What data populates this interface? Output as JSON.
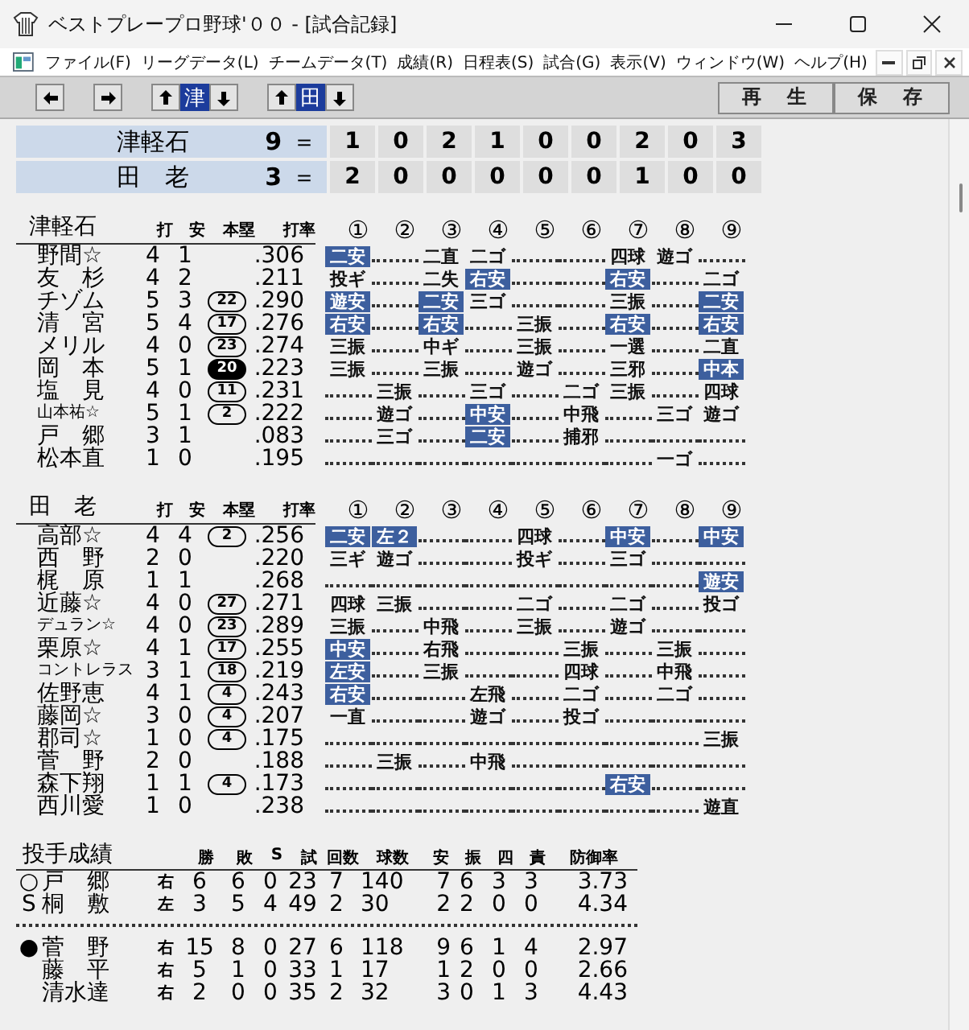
{
  "window": {
    "title": "ベストプレープロ野球'００ - [試合記録]"
  },
  "menu": [
    "ファイル(F)",
    "リーグデータ(L)",
    "チームデータ(T)",
    "成績(R)",
    "日程表(S)",
    "試合(G)",
    "表示(V)",
    "ウィンドウ(W)",
    "ヘルプ(H)"
  ],
  "toolbar": {
    "teams": [
      {
        "label": "津",
        "selected": true
      },
      {
        "label": "田",
        "selected": true
      }
    ],
    "buttons": [
      "再　生",
      "保　存"
    ]
  },
  "scoreboard": [
    {
      "team": "津軽石",
      "runs": "9",
      "separator": "＝",
      "innings": [
        "1",
        "0",
        "2",
        "1",
        "0",
        "0",
        "2",
        "0",
        "3"
      ]
    },
    {
      "team": "田　老",
      "runs": "3",
      "separator": "＝",
      "innings": [
        "2",
        "0",
        "0",
        "0",
        "0",
        "0",
        "1",
        "0",
        "0"
      ]
    }
  ],
  "batting": [
    {
      "team": "津軽石",
      "columns": [
        "打",
        "安",
        "本塁",
        "打率"
      ],
      "innings": [
        "①",
        "②",
        "③",
        "④",
        "⑤",
        "⑥",
        "⑦",
        "⑧",
        "⑨"
      ],
      "batters": [
        {
          "name": "野間☆",
          "compact": false,
          "ab": "4",
          "h": "1",
          "avg": ".306",
          "results": [
            {
              "kind": "hit",
              "text": "二安"
            },
            {
              "kind": "dots"
            },
            {
              "kind": "out",
              "text": "二直"
            },
            {
              "kind": "out",
              "text": "二ゴ"
            },
            {
              "kind": "dots"
            },
            {
              "kind": "dots"
            },
            {
              "kind": "out",
              "text": "四球"
            },
            {
              "kind": "out",
              "text": "遊ゴ"
            },
            {
              "kind": "dots"
            }
          ]
        },
        {
          "name": "友　杉",
          "compact": false,
          "ab": "4",
          "h": "2",
          "avg": ".211",
          "results": [
            {
              "kind": "out",
              "text": "投ギ"
            },
            {
              "kind": "dots"
            },
            {
              "kind": "out",
              "text": "二失"
            },
            {
              "kind": "hit",
              "text": "右安"
            },
            {
              "kind": "dots"
            },
            {
              "kind": "dots"
            },
            {
              "kind": "hit",
              "text": "右安"
            },
            {
              "kind": "dots"
            },
            {
              "kind": "out",
              "text": "二ゴ"
            }
          ]
        },
        {
          "name": "チゾム",
          "compact": false,
          "ab": "5",
          "h": "3",
          "hr": "22",
          "hr_filled": false,
          "avg": ".290",
          "results": [
            {
              "kind": "hit",
              "text": "遊安"
            },
            {
              "kind": "dots"
            },
            {
              "kind": "hit",
              "text": "二安"
            },
            {
              "kind": "out",
              "text": "三ゴ"
            },
            {
              "kind": "dots"
            },
            {
              "kind": "dots"
            },
            {
              "kind": "out",
              "text": "三振"
            },
            {
              "kind": "dots"
            },
            {
              "kind": "hit",
              "text": "二安"
            }
          ]
        },
        {
          "name": "清　宮",
          "compact": false,
          "ab": "5",
          "h": "4",
          "hr": "17",
          "hr_filled": false,
          "avg": ".276",
          "results": [
            {
              "kind": "hit",
              "text": "右安"
            },
            {
              "kind": "dots"
            },
            {
              "kind": "hit",
              "text": "右安"
            },
            {
              "kind": "dots"
            },
            {
              "kind": "out",
              "text": "三振"
            },
            {
              "kind": "dots"
            },
            {
              "kind": "hit",
              "text": "右安"
            },
            {
              "kind": "dots"
            },
            {
              "kind": "hit",
              "text": "右安"
            }
          ]
        },
        {
          "name": "メリル",
          "compact": false,
          "ab": "4",
          "h": "0",
          "hr": "23",
          "hr_filled": false,
          "avg": ".274",
          "results": [
            {
              "kind": "out",
              "text": "三振"
            },
            {
              "kind": "dots"
            },
            {
              "kind": "out",
              "text": "中ギ"
            },
            {
              "kind": "dots"
            },
            {
              "kind": "out",
              "text": "三振"
            },
            {
              "kind": "dots"
            },
            {
              "kind": "out",
              "text": "一選"
            },
            {
              "kind": "dots"
            },
            {
              "kind": "out",
              "text": "二直"
            }
          ]
        },
        {
          "name": "岡　本",
          "compact": false,
          "ab": "5",
          "h": "1",
          "hr": "20",
          "hr_filled": true,
          "avg": ".223",
          "results": [
            {
              "kind": "out",
              "text": "三振"
            },
            {
              "kind": "dots"
            },
            {
              "kind": "out",
              "text": "三振"
            },
            {
              "kind": "dots"
            },
            {
              "kind": "out",
              "text": "遊ゴ"
            },
            {
              "kind": "dots"
            },
            {
              "kind": "out",
              "text": "三邪"
            },
            {
              "kind": "dots"
            },
            {
              "kind": "hit",
              "text": "中本"
            }
          ]
        },
        {
          "name": "塩　見",
          "compact": false,
          "ab": "4",
          "h": "0",
          "hr": "11",
          "hr_filled": false,
          "avg": ".231",
          "results": [
            {
              "kind": "dots"
            },
            {
              "kind": "out",
              "text": "三振"
            },
            {
              "kind": "dots"
            },
            {
              "kind": "out",
              "text": "三ゴ"
            },
            {
              "kind": "dots"
            },
            {
              "kind": "out",
              "text": "二ゴ"
            },
            {
              "kind": "out",
              "text": "三振"
            },
            {
              "kind": "dots"
            },
            {
              "kind": "out",
              "text": "四球"
            }
          ]
        },
        {
          "name": "山本祐☆",
          "compact": true,
          "ab": "5",
          "h": "1",
          "hr": "2",
          "hr_filled": false,
          "avg": ".222",
          "results": [
            {
              "kind": "dots"
            },
            {
              "kind": "out",
              "text": "遊ゴ"
            },
            {
              "kind": "dots"
            },
            {
              "kind": "hit",
              "text": "中安"
            },
            {
              "kind": "dots"
            },
            {
              "kind": "out",
              "text": "中飛"
            },
            {
              "kind": "dots"
            },
            {
              "kind": "out",
              "text": "三ゴ"
            },
            {
              "kind": "out",
              "text": "遊ゴ"
            }
          ]
        },
        {
          "name": "戸　郷",
          "compact": false,
          "ab": "3",
          "h": "1",
          "avg": ".083",
          "results": [
            {
              "kind": "dots"
            },
            {
              "kind": "out",
              "text": "三ゴ"
            },
            {
              "kind": "dots"
            },
            {
              "kind": "hit",
              "text": "二安"
            },
            {
              "kind": "dots"
            },
            {
              "kind": "out",
              "text": "捕邪"
            },
            {
              "kind": "dots"
            },
            {
              "kind": "dots"
            },
            {
              "kind": "dots"
            }
          ]
        },
        {
          "name": "松本直",
          "compact": false,
          "ab": "1",
          "h": "0",
          "avg": ".195",
          "results": [
            {
              "kind": "dots"
            },
            {
              "kind": "dots"
            },
            {
              "kind": "dots"
            },
            {
              "kind": "dots"
            },
            {
              "kind": "dots"
            },
            {
              "kind": "dots"
            },
            {
              "kind": "dots"
            },
            {
              "kind": "out",
              "text": "一ゴ"
            },
            {
              "kind": "dots"
            }
          ]
        }
      ]
    },
    {
      "team": "田　老",
      "columns": [
        "打",
        "安",
        "本塁",
        "打率"
      ],
      "innings": [
        "①",
        "②",
        "③",
        "④",
        "⑤",
        "⑥",
        "⑦",
        "⑧",
        "⑨"
      ],
      "batters": [
        {
          "name": "高部☆",
          "compact": false,
          "ab": "4",
          "h": "4",
          "hr": "2",
          "hr_filled": false,
          "avg": ".256",
          "results": [
            {
              "kind": "hit",
              "text": "二安"
            },
            {
              "kind": "hit",
              "text": "左２"
            },
            {
              "kind": "dots"
            },
            {
              "kind": "dots"
            },
            {
              "kind": "out",
              "text": "四球"
            },
            {
              "kind": "dots"
            },
            {
              "kind": "hit",
              "text": "中安"
            },
            {
              "kind": "dots"
            },
            {
              "kind": "hit",
              "text": "中安"
            }
          ]
        },
        {
          "name": "西　野",
          "compact": false,
          "ab": "2",
          "h": "0",
          "avg": ".220",
          "results": [
            {
              "kind": "out",
              "text": "三ギ"
            },
            {
              "kind": "out",
              "text": "遊ゴ"
            },
            {
              "kind": "dots"
            },
            {
              "kind": "dots"
            },
            {
              "kind": "out",
              "text": "投ギ"
            },
            {
              "kind": "dots"
            },
            {
              "kind": "out",
              "text": "三ゴ"
            },
            {
              "kind": "dots"
            },
            {
              "kind": "dots"
            }
          ]
        },
        {
          "name": "梶　原",
          "compact": false,
          "ab": "1",
          "h": "1",
          "avg": ".268",
          "results": [
            {
              "kind": "dots"
            },
            {
              "kind": "dots"
            },
            {
              "kind": "dots"
            },
            {
              "kind": "dots"
            },
            {
              "kind": "dots"
            },
            {
              "kind": "dots"
            },
            {
              "kind": "dots"
            },
            {
              "kind": "dots"
            },
            {
              "kind": "hit",
              "text": "遊安"
            }
          ]
        },
        {
          "name": "近藤☆",
          "compact": false,
          "ab": "4",
          "h": "0",
          "hr": "27",
          "hr_filled": false,
          "avg": ".271",
          "results": [
            {
              "kind": "out",
              "text": "四球"
            },
            {
              "kind": "out",
              "text": "三振"
            },
            {
              "kind": "dots"
            },
            {
              "kind": "dots"
            },
            {
              "kind": "out",
              "text": "二ゴ"
            },
            {
              "kind": "dots"
            },
            {
              "kind": "out",
              "text": "二ゴ"
            },
            {
              "kind": "dots"
            },
            {
              "kind": "out",
              "text": "投ゴ"
            }
          ]
        },
        {
          "name": "デュラン☆",
          "compact": true,
          "ab": "4",
          "h": "0",
          "hr": "23",
          "hr_filled": false,
          "avg": ".289",
          "results": [
            {
              "kind": "out",
              "text": "三振"
            },
            {
              "kind": "dots"
            },
            {
              "kind": "out",
              "text": "中飛"
            },
            {
              "kind": "dots"
            },
            {
              "kind": "out",
              "text": "三振"
            },
            {
              "kind": "dots"
            },
            {
              "kind": "out",
              "text": "遊ゴ"
            },
            {
              "kind": "dots"
            },
            {
              "kind": "dots"
            }
          ]
        },
        {
          "name": "栗原☆",
          "compact": false,
          "ab": "4",
          "h": "1",
          "hr": "17",
          "hr_filled": false,
          "avg": ".255",
          "results": [
            {
              "kind": "hit",
              "text": "中安"
            },
            {
              "kind": "dots"
            },
            {
              "kind": "out",
              "text": "右飛"
            },
            {
              "kind": "dots"
            },
            {
              "kind": "dots"
            },
            {
              "kind": "out",
              "text": "三振"
            },
            {
              "kind": "dots"
            },
            {
              "kind": "out",
              "text": "三振"
            },
            {
              "kind": "dots"
            }
          ]
        },
        {
          "name": "コントレラス",
          "compact": true,
          "ab": "3",
          "h": "1",
          "hr": "18",
          "hr_filled": false,
          "avg": ".219",
          "results": [
            {
              "kind": "hit",
              "text": "左安"
            },
            {
              "kind": "dots"
            },
            {
              "kind": "out",
              "text": "三振"
            },
            {
              "kind": "dots"
            },
            {
              "kind": "dots"
            },
            {
              "kind": "out",
              "text": "四球"
            },
            {
              "kind": "dots"
            },
            {
              "kind": "out",
              "text": "中飛"
            },
            {
              "kind": "dots"
            }
          ]
        },
        {
          "name": "佐野恵",
          "compact": false,
          "ab": "4",
          "h": "1",
          "hr": "4",
          "hr_filled": false,
          "avg": ".243",
          "results": [
            {
              "kind": "hit",
              "text": "右安"
            },
            {
              "kind": "dots"
            },
            {
              "kind": "dots"
            },
            {
              "kind": "out",
              "text": "左飛"
            },
            {
              "kind": "dots"
            },
            {
              "kind": "out",
              "text": "二ゴ"
            },
            {
              "kind": "dots"
            },
            {
              "kind": "out",
              "text": "二ゴ"
            },
            {
              "kind": "dots"
            }
          ]
        },
        {
          "name": "藤岡☆",
          "compact": false,
          "ab": "3",
          "h": "0",
          "hr": "4",
          "hr_filled": false,
          "avg": ".207",
          "results": [
            {
              "kind": "out",
              "text": "一直"
            },
            {
              "kind": "dots"
            },
            {
              "kind": "dots"
            },
            {
              "kind": "out",
              "text": "遊ゴ"
            },
            {
              "kind": "dots"
            },
            {
              "kind": "out",
              "text": "投ゴ"
            },
            {
              "kind": "dots"
            },
            {
              "kind": "dots"
            },
            {
              "kind": "dots"
            }
          ]
        },
        {
          "name": "郡司☆",
          "compact": false,
          "ab": "1",
          "h": "0",
          "hr": "4",
          "hr_filled": false,
          "avg": ".175",
          "results": [
            {
              "kind": "dots"
            },
            {
              "kind": "dots"
            },
            {
              "kind": "dots"
            },
            {
              "kind": "dots"
            },
            {
              "kind": "dots"
            },
            {
              "kind": "dots"
            },
            {
              "kind": "dots"
            },
            {
              "kind": "dots"
            },
            {
              "kind": "out",
              "text": "三振"
            }
          ]
        },
        {
          "name": "菅　野",
          "compact": false,
          "ab": "2",
          "h": "0",
          "avg": ".188",
          "results": [
            {
              "kind": "dots"
            },
            {
              "kind": "out",
              "text": "三振"
            },
            {
              "kind": "dots"
            },
            {
              "kind": "out",
              "text": "中飛"
            },
            {
              "kind": "dots"
            },
            {
              "kind": "dots"
            },
            {
              "kind": "dots"
            },
            {
              "kind": "dots"
            },
            {
              "kind": "dots"
            }
          ]
        },
        {
          "name": "森下翔",
          "compact": false,
          "ab": "1",
          "h": "1",
          "hr": "4",
          "hr_filled": false,
          "avg": ".173",
          "results": [
            {
              "kind": "dots"
            },
            {
              "kind": "dots"
            },
            {
              "kind": "dots"
            },
            {
              "kind": "dots"
            },
            {
              "kind": "dots"
            },
            {
              "kind": "dots"
            },
            {
              "kind": "hit",
              "text": "右安"
            },
            {
              "kind": "dots"
            },
            {
              "kind": "dots"
            }
          ]
        },
        {
          "name": "西川愛",
          "compact": false,
          "ab": "1",
          "h": "0",
          "avg": ".238",
          "results": [
            {
              "kind": "dots"
            },
            {
              "kind": "dots"
            },
            {
              "kind": "dots"
            },
            {
              "kind": "dots"
            },
            {
              "kind": "dots"
            },
            {
              "kind": "dots"
            },
            {
              "kind": "dots"
            },
            {
              "kind": "dots"
            },
            {
              "kind": "out",
              "text": "遊直"
            }
          ]
        }
      ]
    }
  ],
  "pitching": {
    "title": "投手成績",
    "columns": [
      "勝",
      "敗",
      "S",
      "試",
      "回数",
      "球数",
      "安",
      "振",
      "四",
      "責",
      "防御率"
    ],
    "groups": [
      [
        {
          "mark": "○",
          "name": "戸　郷",
          "hand": "右",
          "stats": [
            "6",
            "6",
            "0",
            "23",
            "7",
            "140",
            "7",
            "6",
            "3",
            "3",
            "3.73"
          ]
        },
        {
          "mark": "S",
          "name": "桐　敷",
          "hand": "左",
          "stats": [
            "3",
            "5",
            "4",
            "49",
            "2",
            "30",
            "2",
            "2",
            "0",
            "0",
            "4.34"
          ]
        }
      ],
      [
        {
          "mark": "●",
          "name": "菅　野",
          "hand": "右",
          "stats": [
            "15",
            "8",
            "0",
            "27",
            "6",
            "118",
            "9",
            "6",
            "1",
            "4",
            "2.97"
          ]
        },
        {
          "name": "藤　平",
          "hand": "右",
          "stats": [
            "5",
            "1",
            "0",
            "33",
            "1",
            "17",
            "1",
            "2",
            "0",
            "0",
            "2.66"
          ]
        },
        {
          "name": "清水達",
          "hand": "右",
          "stats": [
            "2",
            "0",
            "0",
            "35",
            "2",
            "32",
            "3",
            "0",
            "1",
            "3",
            "4.43"
          ]
        }
      ]
    ]
  }
}
